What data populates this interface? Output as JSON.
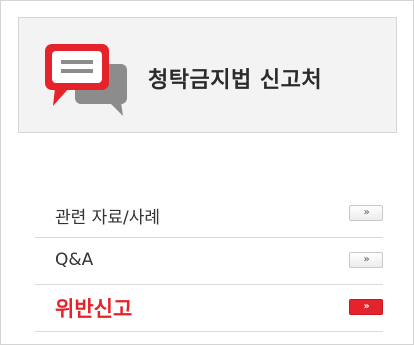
{
  "header": {
    "title": "청탁금지법 신고처",
    "icon": "speech-bubbles-icon"
  },
  "menu": {
    "items": [
      {
        "label": "관련 자료/사례",
        "arrow": "»"
      },
      {
        "label": "Q&A",
        "arrow": "»"
      },
      {
        "label": "위반신고",
        "arrow": "»"
      }
    ]
  },
  "colors": {
    "accent": "#e4232b",
    "header_bg": "#f3f3f3",
    "bubble_gray": "#8c8c8c"
  }
}
